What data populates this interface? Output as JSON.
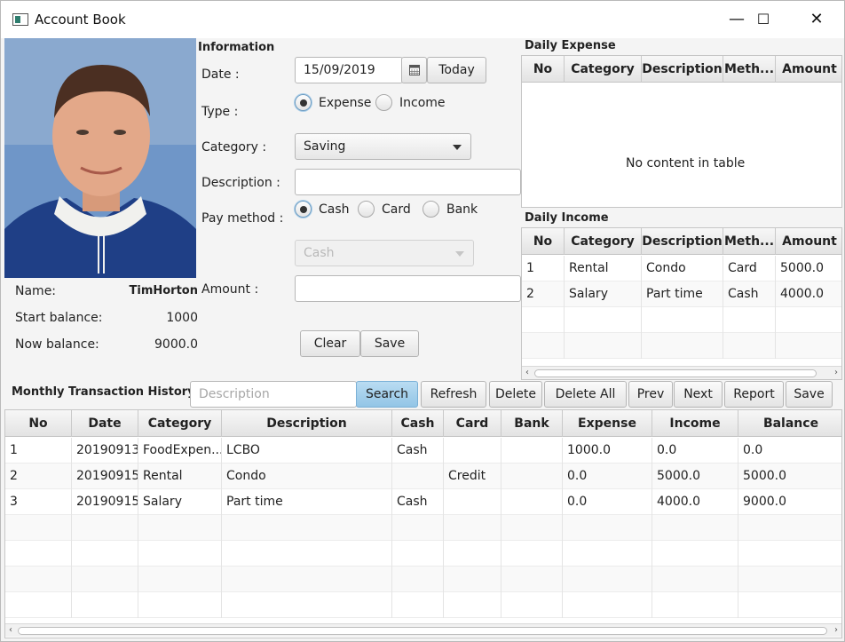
{
  "window": {
    "title": "Account Book",
    "min_glyph": "—",
    "max_glyph": "☐",
    "close_glyph": "✕"
  },
  "profile": {
    "name_label": "Name:",
    "name_value": "TimHorton",
    "start_label": "Start balance:",
    "start_value": "1000",
    "now_label": "Now balance:",
    "now_value": "9000.0"
  },
  "information": {
    "heading": "Information",
    "date_label": "Date :",
    "date_value": "15/09/2019",
    "today_button": "Today",
    "type_label": "Type :",
    "type_options": [
      "Expense",
      "Income"
    ],
    "type_selected": "Expense",
    "category_label": "Category :",
    "category_value": "Saving",
    "description_label": "Description :",
    "description_value": "",
    "pay_label": "Pay method :",
    "pay_options": [
      "Cash",
      "Card",
      "Bank"
    ],
    "pay_selected": "Cash",
    "pay_combo_value": "Cash",
    "amount_label": "Amount :",
    "amount_value": "",
    "clear_button": "Clear",
    "save_button": "Save"
  },
  "daily_expense": {
    "heading": "Daily Expense",
    "columns": [
      "No",
      "Category",
      "Description",
      "Meth...",
      "Amount"
    ],
    "empty_text": "No content in table",
    "rows": []
  },
  "daily_income": {
    "heading": "Daily Income",
    "columns": [
      "No",
      "Category",
      "Description",
      "Meth...",
      "Amount"
    ],
    "rows": [
      [
        "1",
        "Rental",
        "Condo",
        "Card",
        "5000.0"
      ],
      [
        "2",
        "Salary",
        "Part time",
        "Cash",
        "4000.0"
      ]
    ]
  },
  "monthly": {
    "heading": "Monthly Transaction History",
    "search_placeholder": "Description",
    "buttons": [
      "Search",
      "Refresh",
      "Delete",
      "Delete All",
      "Prev",
      "Next",
      "Report",
      "Save"
    ],
    "columns": [
      "No",
      "Date",
      "Category",
      "Description",
      "Cash",
      "Card",
      "Bank",
      "Expense",
      "Income",
      "Balance"
    ],
    "rows": [
      [
        "1",
        "20190913",
        "FoodExpen...",
        "LCBO",
        "Cash",
        "",
        "",
        "1000.0",
        "0.0",
        "0.0"
      ],
      [
        "2",
        "20190915",
        "Rental",
        "Condo",
        "",
        "Credit",
        "",
        "0.0",
        "5000.0",
        "5000.0"
      ],
      [
        "3",
        "20190915",
        "Salary",
        "Part time",
        "Cash",
        "",
        "",
        "0.0",
        "4000.0",
        "9000.0"
      ]
    ]
  },
  "colors": {
    "primary_button": "#9fcdea",
    "header": "#e8e8e8",
    "window_bg": "#f4f4f4"
  },
  "icons": [
    "calendar-icon",
    "app-icon",
    "dropdown-arrow-icon"
  ]
}
